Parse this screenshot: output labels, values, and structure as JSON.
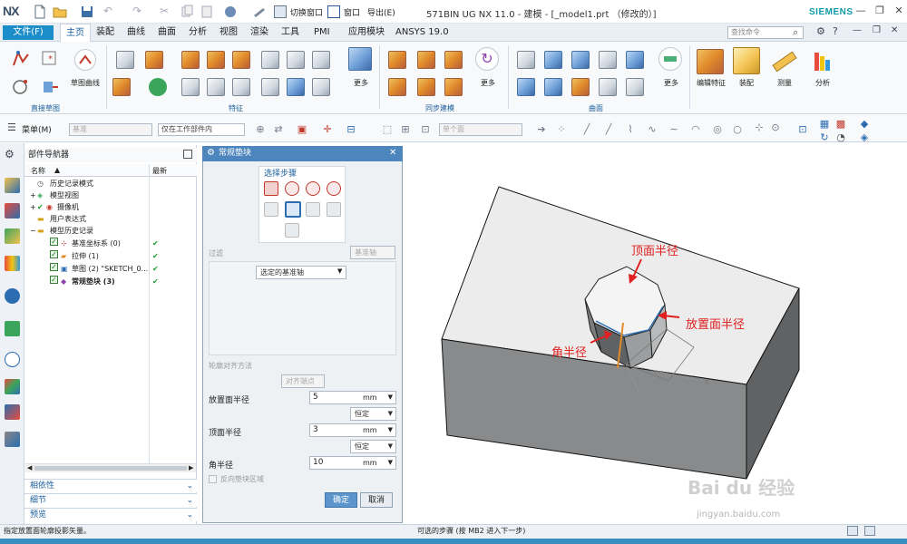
{
  "app": {
    "logo": "NX",
    "window_title": "571BIN UG NX 11.0 - 建模 - [_model1.prt （修改的）]",
    "brand": "SIEMENS",
    "switch_window": "切换窗口",
    "window_menu": "窗口",
    "export_menu": "导出(E)"
  },
  "menu": {
    "file": "文件(F)",
    "tabs": [
      "主页",
      "装配",
      "曲线",
      "曲面",
      "分析",
      "视图",
      "渲染",
      "工具",
      "PMI",
      "应用模块",
      "ANSYS 19.0"
    ],
    "search_placeholder": "查找命令"
  },
  "ribbon": {
    "sketch_curve": "草图曲线",
    "direct_sketch": "直接草图",
    "feature": "特征",
    "sync_modeling": "同步建模",
    "surface": "曲面",
    "more": "更多",
    "edit_feature": "编辑特征",
    "assembly": "装配",
    "measure": "测量",
    "analysis": "分析"
  },
  "toolbar": {
    "menu": "菜单(M)",
    "filter1": "基准",
    "filter2": "仅在工作部件内",
    "filter3": "单个面"
  },
  "navigator": {
    "title": "部件导航器",
    "col_name": "名称",
    "col_latest": "最新",
    "items": [
      {
        "label": "历史记录模式",
        "latest": ""
      },
      {
        "label": "模型视图",
        "latest": ""
      },
      {
        "label": "摄像机",
        "latest": ""
      },
      {
        "label": "用户表达式",
        "latest": ""
      },
      {
        "label": "模型历史记录",
        "latest": ""
      },
      {
        "label": "基准坐标系 (0)",
        "latest": "✔"
      },
      {
        "label": "拉伸 (1)",
        "latest": "✔"
      },
      {
        "label": "草图 (2) \"SKETCH_0...",
        "latest": "✔"
      },
      {
        "label": "常规垫块 (3)",
        "latest": "✔"
      }
    ],
    "panels": [
      "相依性",
      "细节",
      "预览"
    ]
  },
  "dialog": {
    "title": "常规垫块",
    "select_steps": "选择步骤",
    "filter_label": "过滤",
    "filter_value": "基准轴",
    "selected_axis": "选定的基准轴",
    "profile_align": "轮廓对齐方法",
    "align_value": "对齐端点",
    "place_radius_label": "放置面半径",
    "place_radius_value": "5",
    "top_radius_label": "顶面半径",
    "top_radius_value": "3",
    "corner_radius_label": "角半径",
    "corner_radius_value": "10",
    "unit": "mm",
    "constant": "恒定",
    "reverse_region": "反向垫块区域",
    "ok": "确定",
    "cancel": "取消"
  },
  "annotations": {
    "top_radius": "顶面半径",
    "place_radius": "放置面半径",
    "corner_radius": "角半径"
  },
  "status": {
    "left": "指定放置面轮廓投影矢量。",
    "center": "可选的步骤 (按 MB2 进入下一步)"
  },
  "watermark": {
    "text": "Bai du 经验",
    "url": "jingyan.baidu.com"
  }
}
